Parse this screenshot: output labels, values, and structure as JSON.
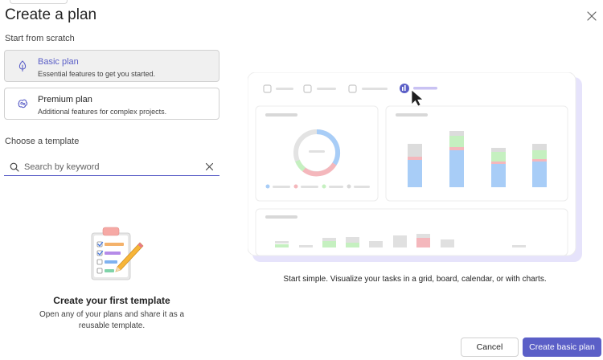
{
  "dialog": {
    "title": "Create a plan",
    "close_label": "Close"
  },
  "scratch": {
    "heading": "Start from scratch",
    "plans": [
      {
        "name": "Basic plan",
        "description": "Essential features to get you started.",
        "icon": "basic-plan-icon",
        "selected": true
      },
      {
        "name": "Premium plan",
        "description": "Additional features for complex projects.",
        "icon": "premium-plan-icon",
        "selected": false
      }
    ]
  },
  "template": {
    "heading": "Choose a template",
    "search_placeholder": "Search by keyword",
    "search_value": "",
    "empty_title": "Create your first template",
    "empty_description": "Open any of your plans and share it as a reusable template."
  },
  "preview": {
    "caption": "Start simple. Visualize your tasks in a grid, board, calendar, or with charts."
  },
  "actions": {
    "cancel": "Cancel",
    "create": "Create basic plan"
  },
  "colors": {
    "accent": "#5b5fc7",
    "chart_blue": "#a8cdf7",
    "chart_green": "#c5f0c0",
    "chart_red": "#f4b7bc",
    "chart_gray": "#dcdcdc"
  }
}
